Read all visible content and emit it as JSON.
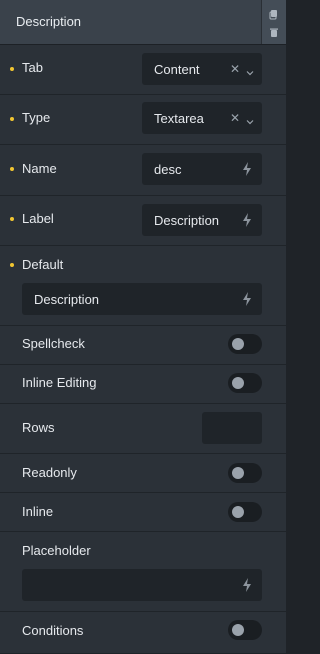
{
  "header": {
    "title": "Description"
  },
  "fields": {
    "tab": {
      "label": "Tab",
      "value": "Content"
    },
    "type": {
      "label": "Type",
      "value": "Textarea"
    },
    "name": {
      "label": "Name",
      "value": "desc"
    },
    "label": {
      "label": "Label",
      "value": "Description"
    },
    "default": {
      "label": "Default",
      "value": "Description"
    },
    "spellcheck": {
      "label": "Spellcheck",
      "enabled": false
    },
    "inline_editing": {
      "label": "Inline Editing",
      "enabled": false
    },
    "rows": {
      "label": "Rows",
      "value": ""
    },
    "readonly": {
      "label": "Readonly",
      "enabled": false
    },
    "inline": {
      "label": "Inline",
      "enabled": false
    },
    "placeholder": {
      "label": "Placeholder",
      "value": ""
    },
    "conditions": {
      "label": "Conditions",
      "enabled": false
    }
  },
  "colors": {
    "accent_dot": "#f0c531",
    "panel_bg": "#2b3138",
    "control_bg": "#1f2429"
  },
  "icons": [
    "copy-icon",
    "trash-icon",
    "clear-icon",
    "chevron-down-icon",
    "dynamic-data-bolt-icon"
  ]
}
